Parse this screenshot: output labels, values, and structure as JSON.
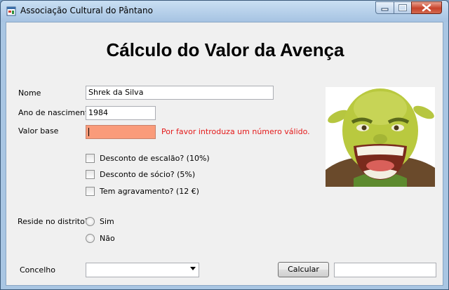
{
  "window": {
    "title": "Associação Cultural do Pântano"
  },
  "form": {
    "heading": "Cálculo do Valor da Avença",
    "nome": {
      "label": "Nome",
      "value": "Shrek da Silva"
    },
    "ano": {
      "label": "Ano de nascimento",
      "value": "1984"
    },
    "valor_base": {
      "label": "Valor base",
      "value": "",
      "error": "Por favor introduza um número válido."
    },
    "checkboxes": [
      {
        "label": "Desconto de escalão? (10%)",
        "checked": false
      },
      {
        "label": "Desconto de sócio? (5%)",
        "checked": false
      },
      {
        "label": "Tem agravamento? (12 €)",
        "checked": false
      }
    ],
    "distrito": {
      "label": "Reside no distrito?",
      "options": [
        {
          "label": "Sim",
          "selected": false
        },
        {
          "label": "Não",
          "selected": false
        }
      ]
    },
    "concelho": {
      "label": "Concelho",
      "selected": ""
    },
    "calcular_label": "Calcular",
    "resultado": ""
  },
  "colors": {
    "error_field_bg": "#fa9b7a",
    "error_text": "#e41a1a"
  },
  "icons": [
    "app-icon",
    "minimize-icon",
    "maximize-icon",
    "close-icon",
    "combo-arrow-icon"
  ]
}
